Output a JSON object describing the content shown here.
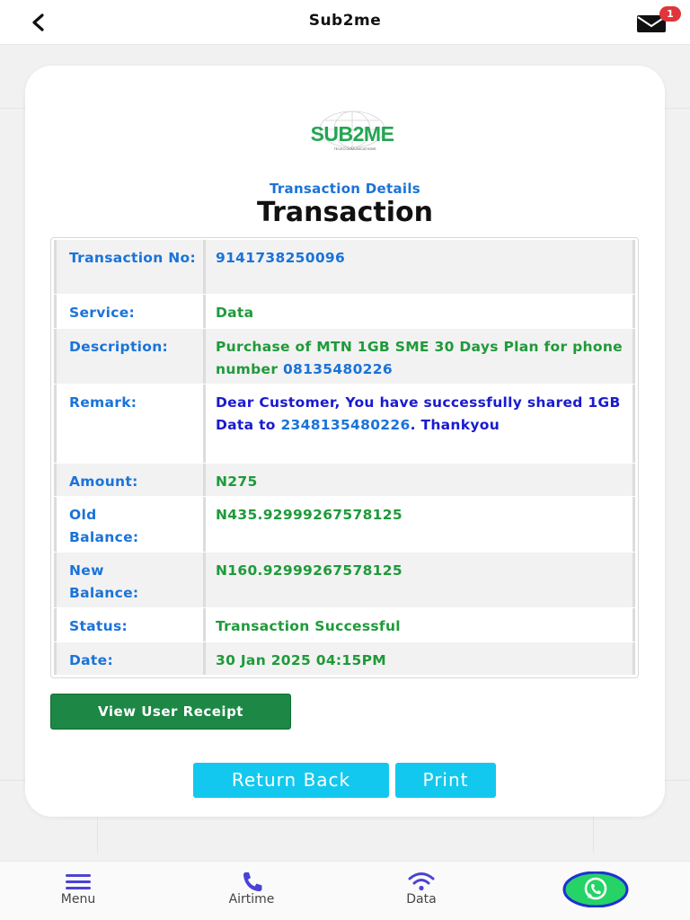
{
  "header": {
    "title": "Sub2me",
    "notification_count": "1"
  },
  "logo": {
    "text": "SUB2ME",
    "tagline": "TELECOMMUNICATIONS"
  },
  "page": {
    "subtitle": "Transaction Details",
    "heading": "Transaction"
  },
  "details": {
    "transaction_no": {
      "label": "Transaction No:",
      "value": "9141738250096"
    },
    "service": {
      "label": "Service:",
      "value": "Data"
    },
    "description": {
      "label": "Description:",
      "value": "Purchase of MTN 1GB SME 30 Days Plan for phone number ",
      "phone": "08135480226"
    },
    "remark": {
      "label": "Remark:",
      "value_a": "Dear Customer, You have successfully shared 1GB Data to ",
      "phone": "2348135480226",
      "value_b": ". Thankyou"
    },
    "amount": {
      "label": "Amount:",
      "value": "N275"
    },
    "old_balance": {
      "label": "Old Balance:",
      "value": "N435.92999267578125"
    },
    "new_balance": {
      "label": "New Balance:",
      "value": "N160.92999267578125"
    },
    "status": {
      "label": "Status:",
      "value": "Transaction Successful"
    },
    "date": {
      "label": "Date:",
      "value": "30 Jan 2025 04:15PM"
    }
  },
  "buttons": {
    "view_receipt": "View User Receipt",
    "return_back": "Return Back",
    "print": "Print"
  },
  "bottom_nav": {
    "menu": "Menu",
    "airtime": "Airtime",
    "data": "Data"
  },
  "colors": {
    "accent_blue": "#1a73d9",
    "success_green": "#1f9a3a",
    "receipt_button": "#1d8745",
    "action_button": "#13c8ee",
    "nav_icon": "#4b43d6",
    "whatsapp": "#25d366"
  },
  "icons": {
    "back": "back-arrow-icon",
    "theme": "moon-icon",
    "mail": "mail-icon",
    "menu": "hamburger-icon",
    "airtime": "phone-icon",
    "data": "wifi-icon",
    "whatsapp": "whatsapp-icon"
  }
}
